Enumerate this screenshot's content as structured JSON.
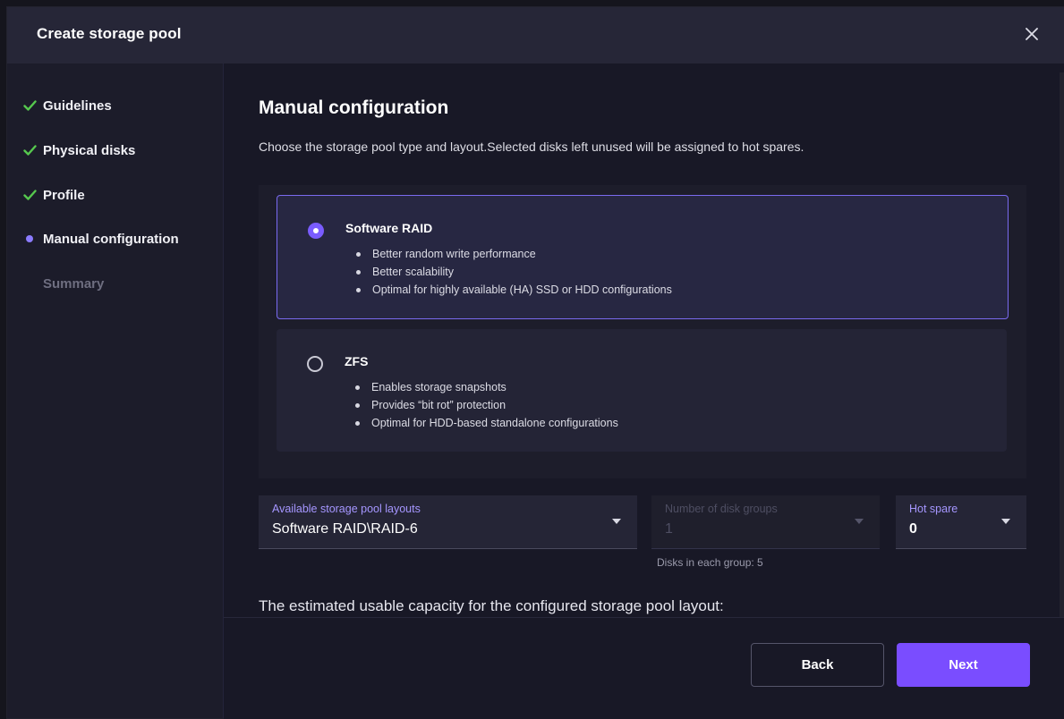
{
  "dialog": {
    "title": "Create storage pool"
  },
  "icons": {
    "close": "close-icon",
    "completed": "checkmark-icon",
    "current": "current-step-dot",
    "radio": "radio-button"
  },
  "colors": {
    "accent": "#7a4dff",
    "check": "#56c84e",
    "label_accent": "#a596ff"
  },
  "steps": [
    {
      "label": "Guidelines",
      "status": "done"
    },
    {
      "label": "Physical disks",
      "status": "done"
    },
    {
      "label": "Profile",
      "status": "done"
    },
    {
      "label": "Manual configuration",
      "status": "current"
    },
    {
      "label": "Summary",
      "status": "pending"
    }
  ],
  "main": {
    "title": "Manual configuration",
    "description": "Choose the storage pool type and layout.Selected disks left unused will be assigned to hot spares.",
    "options": [
      {
        "name": "Software RAID",
        "selected": true,
        "features": [
          "Better random write performance",
          "Better scalability",
          "Optimal for highly available (HA) SSD or HDD configurations"
        ]
      },
      {
        "name": "ZFS",
        "selected": false,
        "features": [
          "Enables storage snapshots",
          "Provides “bit rot” protection",
          "Optimal for HDD-based standalone configurations"
        ]
      }
    ],
    "layout_select": {
      "label": "Available storage pool layouts",
      "value": "Software RAID\\RAID-6"
    },
    "disk_groups_select": {
      "label": "Number of disk groups",
      "value": "1",
      "disabled": true,
      "helper": "Disks in each group: 5"
    },
    "hot_spare_select": {
      "label": "Hot spare",
      "value": "0"
    },
    "capacity_text": "The estimated usable capacity for the configured storage pool layout:"
  },
  "footer": {
    "back_label": "Back",
    "next_label": "Next"
  }
}
